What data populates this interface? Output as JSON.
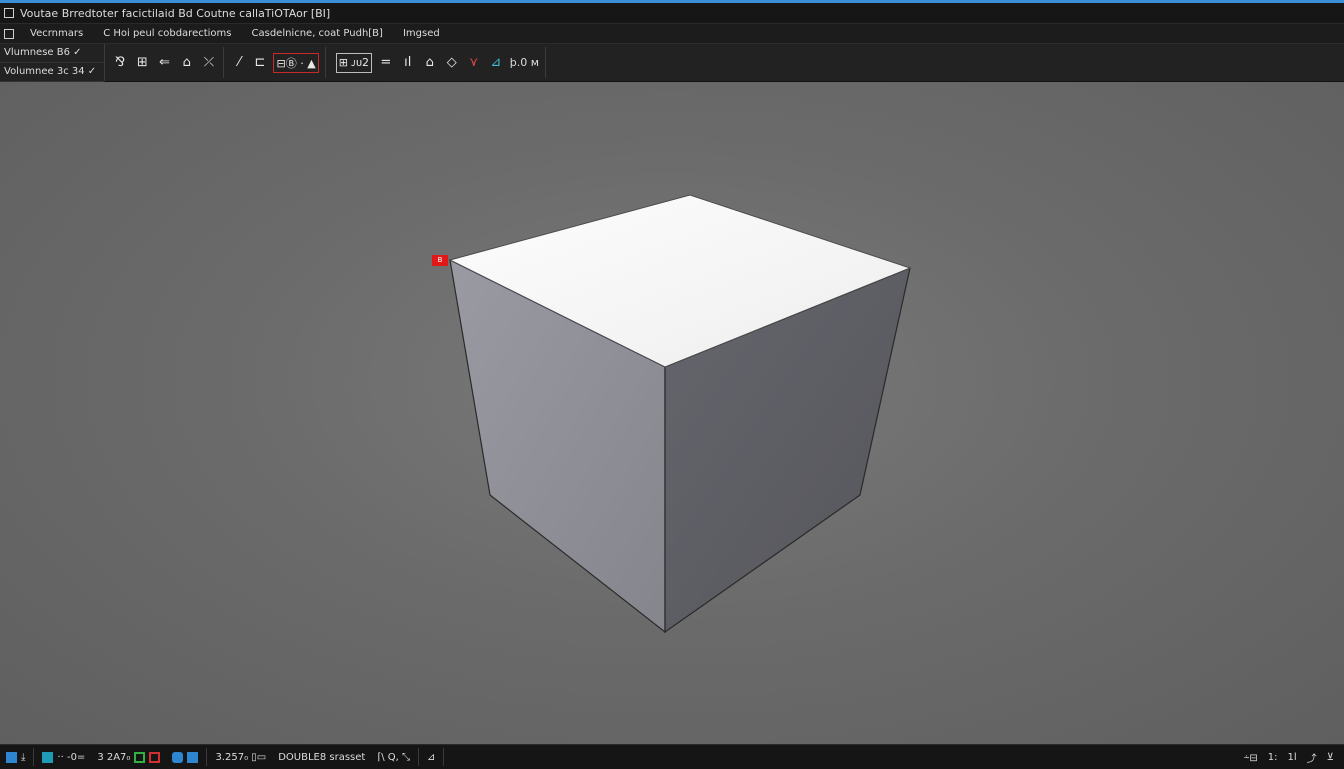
{
  "window": {
    "title": "Voutae Brredtoter  facictilaid  Bd  Coutne callaTiOTAor  [BI]"
  },
  "menu": {
    "items": [
      "Vecrnmars",
      "C Hoi peul cobdarectioms",
      "Casdelnicne, coat Pudh[B]",
      "Imgsed"
    ]
  },
  "toolbar": {
    "volume_row1": "Vlumnese B6 ✓",
    "volume_row2": "Volumnee 3c 34 ✓",
    "group1_icons": [
      "⅋",
      "⊞",
      "⇐",
      "⌂",
      "⤫"
    ],
    "group2_icons": [
      "⁄",
      "⊏"
    ],
    "group2_active_label": "⊟Ⓑ · ▲",
    "group3_framed_label": "⊞ ᴊᴜ2",
    "group3_icons": [
      "=",
      "ıl",
      "⌂",
      "◇",
      "⋎",
      "⊿"
    ],
    "group3_tail_label": "þ.0 ᴍ"
  },
  "viewport": {
    "vertex_marker_label": "B"
  },
  "status_bar": {
    "item_a": "·· -0=",
    "item_b": "3 2A7₀",
    "item_c": "3.257₀ ▯▭",
    "item_d": "DOUBLE8 srasset",
    "item_e": "⌈\\ Q, ⤡",
    "item_f": "⊿",
    "right_a": "⸞⊟",
    "right_b": "1:",
    "right_c": "1l",
    "right_d": "⤴",
    "right_e": "⊻"
  },
  "colors": {
    "accent": "#3a8fd6",
    "selection": "#e01818",
    "viewport_bg": "#6b6b6b"
  }
}
